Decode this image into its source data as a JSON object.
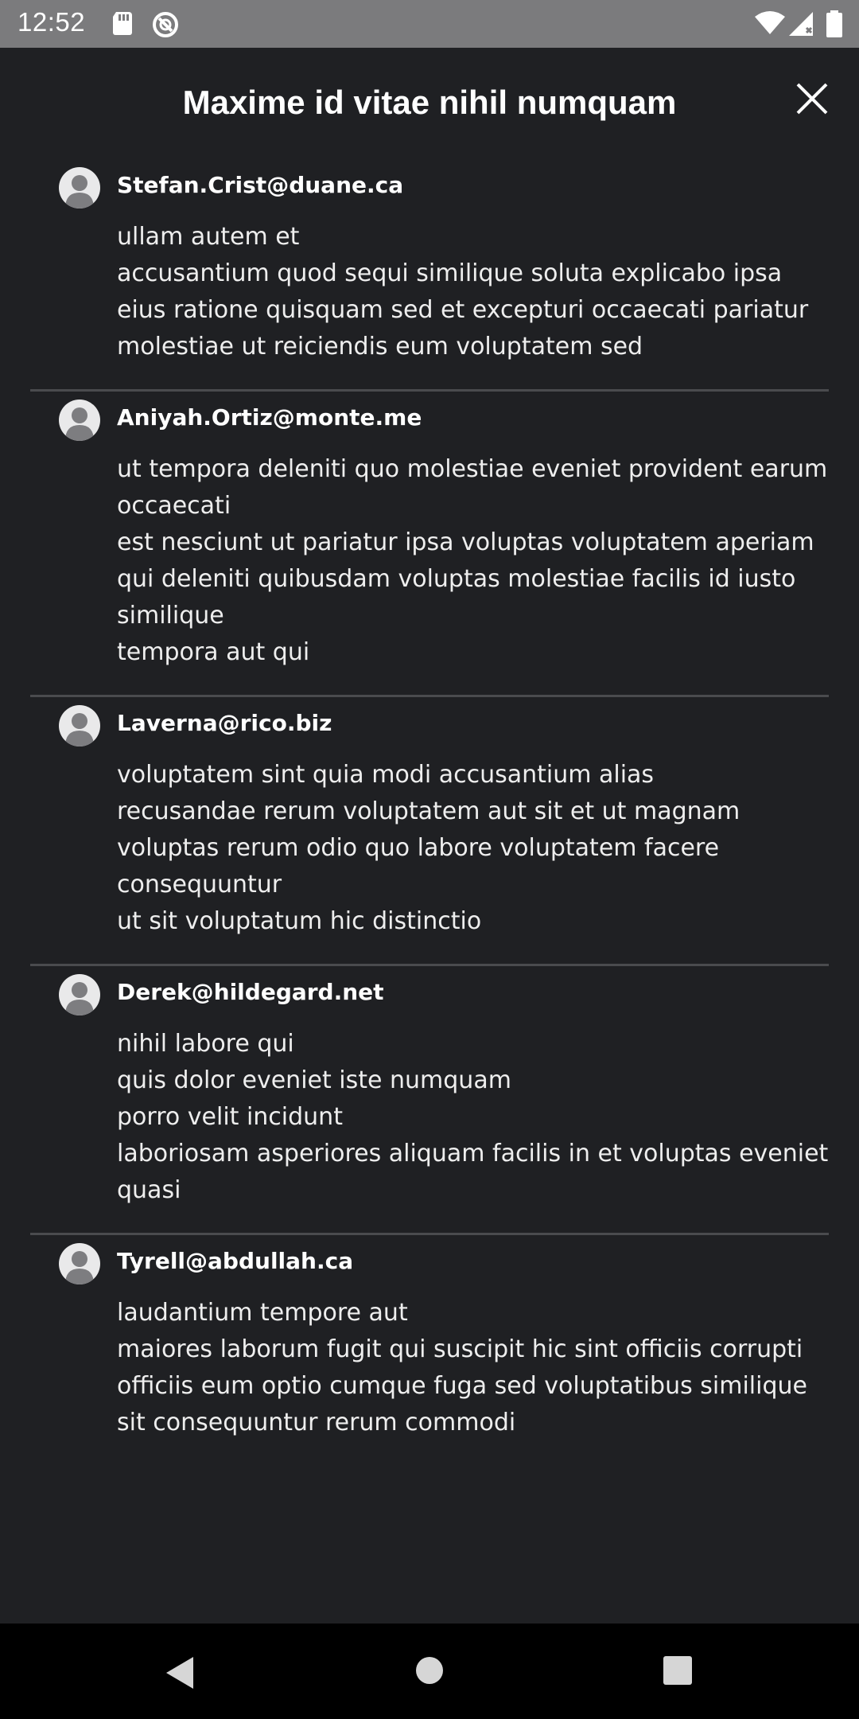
{
  "status_bar": {
    "time": "12:52",
    "icons": [
      "sd-card-icon",
      "sync-icon",
      "wifi-icon",
      "signal-icon",
      "battery-icon"
    ]
  },
  "dialog": {
    "title": "Maxime id vitae nihil numquam",
    "close_icon": "close-icon"
  },
  "comments": [
    {
      "author": "Stefan.Crist@duane.ca",
      "lines": [
        "ullam autem et",
        "accusantium quod sequi similique soluta explicabo ipsa eius ratione quisquam sed et excepturi occaecati pariatur molestiae ut reiciendis eum voluptatem sed"
      ]
    },
    {
      "author": "Aniyah.Ortiz@monte.me",
      "lines": [
        "ut tempora deleniti quo molestiae eveniet provident earum occaecati",
        "est nesciunt ut pariatur ipsa voluptas voluptatem aperiam qui deleniti quibusdam voluptas molestiae facilis id iusto similique",
        "tempora aut qui"
      ]
    },
    {
      "author": "Laverna@rico.biz",
      "lines": [
        "voluptatem sint quia modi accusantium alias",
        "recusandae rerum voluptatem aut sit et ut magnam",
        "voluptas rerum odio quo labore voluptatem facere consequuntur",
        "ut sit voluptatum hic distinctio"
      ]
    },
    {
      "author": "Derek@hildegard.net",
      "lines": [
        "nihil labore qui",
        "quis dolor eveniet iste numquam",
        "porro velit incidunt",
        "laboriosam asperiores aliquam facilis in et voluptas eveniet quasi"
      ]
    },
    {
      "author": "Tyrell@abdullah.ca",
      "lines": [
        "laudantium tempore aut",
        "maiores laborum fugit qui suscipit hic sint officiis corrupti officiis eum optio cumque fuga sed voluptatibus similique sit consequuntur rerum commodi"
      ]
    }
  ],
  "nav_bar": {
    "buttons": [
      "back-icon",
      "home-icon",
      "recents-icon"
    ]
  },
  "colors": {
    "background": "#1f2023",
    "status_bar": "#7b7b7d",
    "divider": "#4a4b4e",
    "text": "#ffffff"
  }
}
